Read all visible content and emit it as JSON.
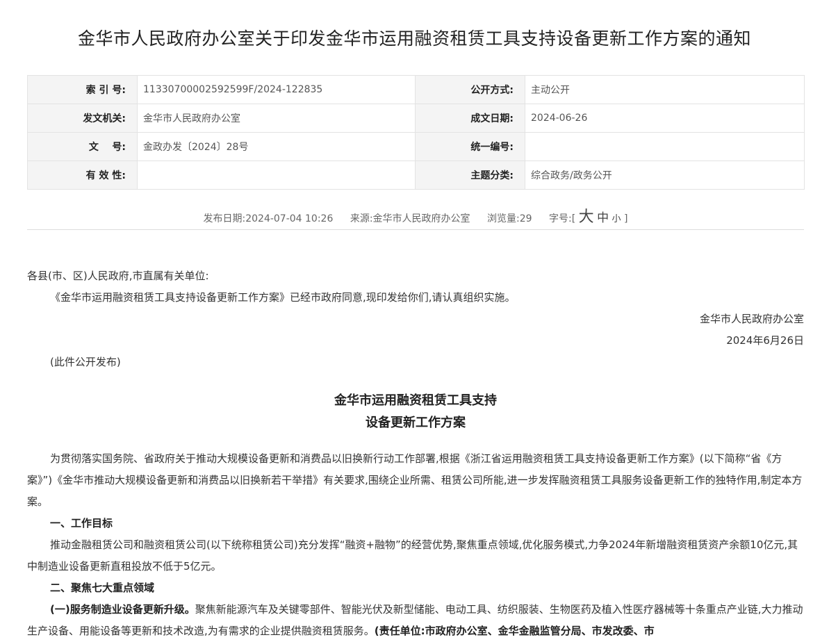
{
  "title": "金华市人民政府办公室关于印发金华市运用融资租赁工具支持设备更新工作方案的通知",
  "meta": {
    "index_label": "索 引 号:",
    "index_value": "11330700002592599F/2024-122835",
    "open_mode_label": "公开方式:",
    "open_mode_value": "主动公开",
    "issuer_label": "发文机关:",
    "issuer_value": "金华市人民政府办公室",
    "date_label": "成文日期:",
    "date_value": "2024-06-26",
    "doc_no_label": "文    号:",
    "doc_no_value": "金政办发〔2024〕28号",
    "unified_no_label": "统一编号:",
    "unified_no_value": "",
    "validity_label": "有 效 性:",
    "validity_value": "",
    "topic_label": "主题分类:",
    "topic_value": "综合政务/政务公开"
  },
  "pubinfo": {
    "publish_date": "发布日期:2024-07-04 10:26",
    "source": "来源:金华市人民政府办公室",
    "views": "浏览量:29",
    "font_size_label": "字号:[",
    "size_large": "大",
    "size_medium": "中",
    "size_small": "小",
    "bracket_close": "]"
  },
  "body": {
    "salutation": "各县(市、区)人民政府,市直属有关单位:",
    "intro": "《金华市运用融资租赁工具支持设备更新工作方案》已经市政府同意,现印发给你们,请认真组织实施。",
    "signature": "金华市人民政府办公室",
    "sign_date": "2024年6月26日",
    "note": "(此件公开发布)",
    "plan_title_1": "金华市运用融资租赁工具支持",
    "plan_title_2": "设备更新工作方案",
    "para1": "为贯彻落实国务院、省政府关于推动大规模设备更新和消费品以旧换新行动工作部署,根据《浙江省运用融资租赁工具支持设备更新工作方案》(以下简称“省《方案》”)《金华市推动大规模设备更新和消费品以旧换新若干举措》有关要求,围绕企业所需、租赁公司所能,进一步发挥融资租赁工具服务设备更新工作的独特作用,制定本方案。",
    "heading1": "一、工作目标",
    "para2": "推动金融租赁公司和融资租赁公司(以下统称租赁公司)充分发挥“融资+融物”的经营优势,聚焦重点领域,优化服务模式,力争2024年新增融资租赁资产余额10亿元,其中制造业设备更新直租投放不低于5亿元。",
    "heading2": "二、聚焦七大重点领域",
    "sub1_title": "(一)服务制造业设备更新升级。",
    "sub1_text": "聚焦新能源汽车及关键零部件、智能光伏及新型储能、电动工具、纺织服装、生物医药及植入性医疗器械等十条重点产业链,大力推动生产设备、用能设备等更新和技术改造,为有需求的企业提供融资租赁服务。",
    "sub1_resp": "(责任单位:市政府办公室、金华金融监管分局、市发改委、市"
  }
}
